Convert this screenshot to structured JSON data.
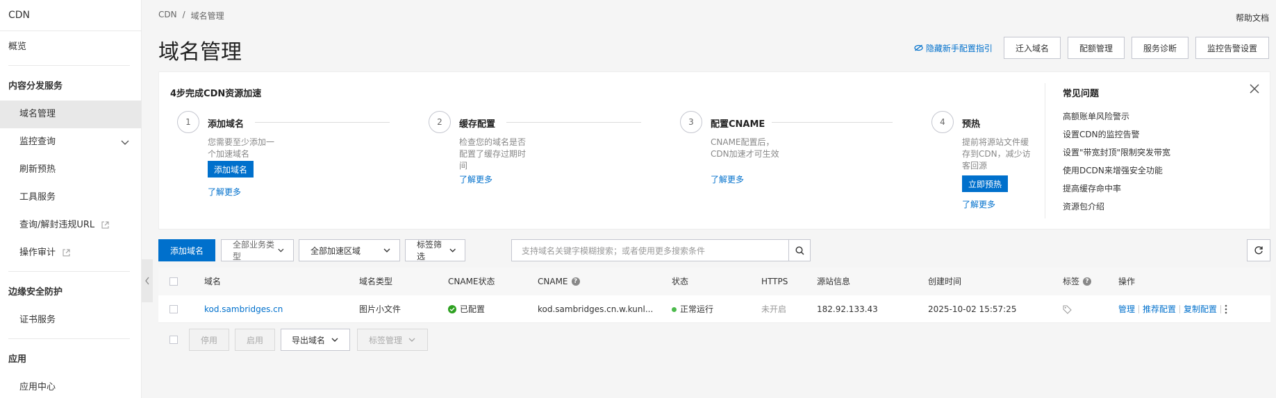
{
  "sidebar": {
    "title": "CDN",
    "overview": "概览",
    "group_content": "内容分发服务",
    "items_content": [
      "域名管理",
      "监控查询",
      "刷新预热",
      "工具服务",
      "查询/解封违规URL",
      "操作审计"
    ],
    "group_security": "边缘安全防护",
    "items_security": [
      "证书服务"
    ],
    "group_app": "应用",
    "items_app": [
      "应用中心"
    ]
  },
  "header": {
    "breadcrumb": [
      "CDN",
      "/",
      "域名管理"
    ],
    "help": "帮助文档",
    "title": "域名管理",
    "hide_guide": "隐藏新手配置指引",
    "actions": [
      "迁入域名",
      "配额管理",
      "服务诊断",
      "监控告警设置"
    ]
  },
  "guide": {
    "title": "4步完成CDN资源加速",
    "steps": [
      {
        "num": "1",
        "name": "添加域名",
        "desc": "您需要至少添加一个加速域名",
        "button": "添加域名",
        "more": "了解更多"
      },
      {
        "num": "2",
        "name": "缓存配置",
        "desc": "检查您的域名是否配置了缓存过期时间",
        "more": "了解更多"
      },
      {
        "num": "3",
        "name": "配置CNAME",
        "desc": "CNAME配置后，CDN加速才可生效",
        "more": "了解更多"
      },
      {
        "num": "4",
        "name": "预热",
        "desc": "提前将源站文件缓存到CDN，减少访客回源",
        "button": "立即预热",
        "more": "了解更多"
      }
    ],
    "faq_title": "常见问题",
    "faq": [
      "高额账单风险警示",
      "设置CDN的监控告警",
      "设置\"带宽封顶\"限制突发带宽",
      "使用DCDN来增强安全功能",
      "提高缓存命中率",
      "资源包介绍"
    ]
  },
  "toolbar": {
    "add_domain": "添加域名",
    "business_type": "全部业务类型",
    "region": "全部加速区域",
    "tag_filter": "标签筛选",
    "search_placeholder": "支持域名关键字模糊搜索；或者使用更多搜索条件"
  },
  "table": {
    "columns": [
      "域名",
      "域名类型",
      "CNAME状态",
      "CNAME",
      "状态",
      "HTTPS",
      "源站信息",
      "创建时间",
      "标签",
      "操作"
    ],
    "rows": [
      {
        "domain": "kod.sambridges.cn",
        "type": "图片小文件",
        "cname_status": "已配置",
        "cname": "kod.sambridges.cn.w.kunl...",
        "status": "正常运行",
        "https": "未开启",
        "origin": "182.92.133.43",
        "created": "2025-10-02 15:57:25",
        "ops": [
          "管理",
          "推荐配置",
          "复制配置"
        ]
      }
    ]
  },
  "bottom": {
    "disable": "停用",
    "enable": "启用",
    "export": "导出域名",
    "tag_manage": "标签管理"
  },
  "colors": {
    "primary": "#0070cc",
    "success": "#4cba4c"
  }
}
